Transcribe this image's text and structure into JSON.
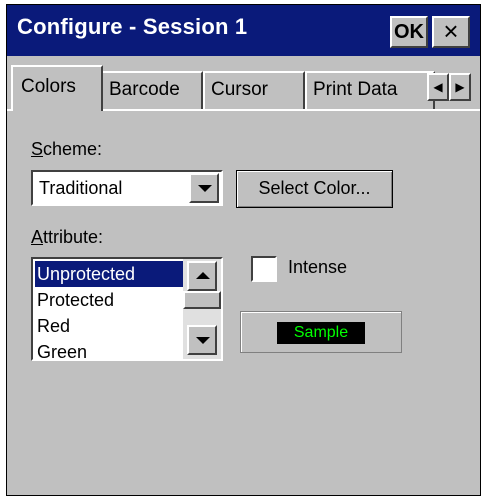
{
  "window": {
    "title": "Configure - Session 1",
    "ok_label": "OK",
    "close_label": "×"
  },
  "tabs": [
    {
      "label": "Colors",
      "active": true
    },
    {
      "label": "Barcode",
      "active": false
    },
    {
      "label": "Cursor",
      "active": false
    },
    {
      "label": "Print Data",
      "active": false
    }
  ],
  "tab_scroll": {
    "left": "◀",
    "right": "▶"
  },
  "scheme": {
    "label_first": "S",
    "label_rest": "cheme:",
    "value": "Traditional"
  },
  "select_color_label": "Select Color...",
  "attribute": {
    "label_first": "A",
    "label_rest": "ttribute:",
    "items": [
      "Unprotected",
      "Protected",
      "Red",
      "Green"
    ],
    "selected": "Unprotected"
  },
  "intense": {
    "label": "Intense",
    "checked": false
  },
  "sample": {
    "label": "Sample",
    "fg": "#00ff00",
    "bg": "#000000"
  },
  "colors": {
    "titlebar": "#0a1a7a",
    "selection": "#0a1a7a",
    "face": "#c0c0c0"
  }
}
